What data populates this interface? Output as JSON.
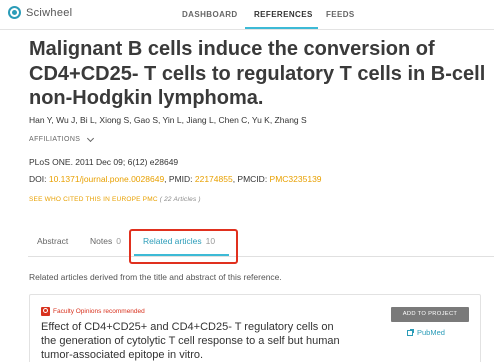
{
  "app": {
    "name": "Sciwheel"
  },
  "nav": {
    "dashboard": "DASHBOARD",
    "references": "REFERENCES",
    "feeds": "FEEDS",
    "active": "REFERENCES"
  },
  "article": {
    "title": "Malignant B cells induce the conversion of CD4+CD25- T cells to regulatory T cells in B-cell non-Hodgkin lymphoma.",
    "authors": "Han Y, Wu J, Bi L, Xiong S, Gao S, Yin L, Jiang L, Chen C, Yu K, Zhang S",
    "affiliations_label": "AFFILIATIONS",
    "citation": "PLoS ONE. 2011 Dec 09; 6(12) e28649",
    "doi_label": "DOI: ",
    "doi": "10.1371/journal.pone.0028649",
    "pmid_label": ", PMID: ",
    "pmid": "22174855",
    "pmcid_label": ", PMCID: ",
    "pmcid": "PMC3235139",
    "cited_label": "SEE WHO CITED THIS IN EUROPE PMC",
    "cited_count": "( 22 Articles )"
  },
  "tabs": [
    {
      "label": "Abstract",
      "count": ""
    },
    {
      "label": "Notes",
      "count": "0"
    },
    {
      "label": "Related articles",
      "count": "10",
      "active": true
    }
  ],
  "related": {
    "description": "Related articles derived from the title and abstract of this reference.",
    "items": [
      {
        "badge": "Faculty Opinions recommended",
        "title": "Effect of CD4+CD25+ and CD4+CD25- T regulatory cells on the generation of cytolytic T cell response to a self but human tumor-associated epitope in vitro.",
        "add_button": "ADD TO PROJECT",
        "source_link": "PubMed"
      }
    ]
  },
  "colors": {
    "accent": "#3dbad6",
    "link_orange": "#e8a000",
    "highlight_red": "#e0301e",
    "badge_red": "#d8321e"
  }
}
